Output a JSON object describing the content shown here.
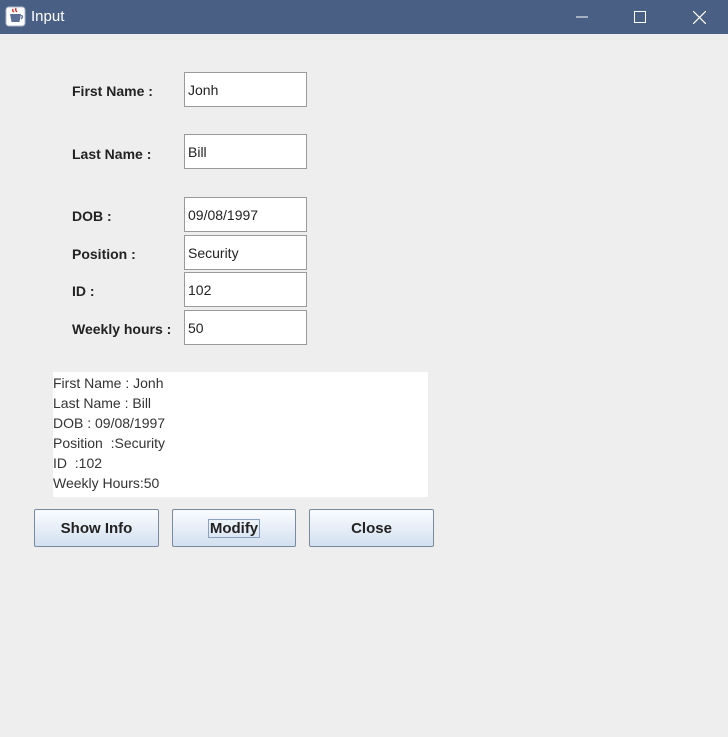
{
  "window": {
    "title": "Input",
    "app_icon": "java-cup-icon",
    "controls": [
      "minimize-icon",
      "maximize-icon",
      "close-icon"
    ]
  },
  "form": {
    "first_name": {
      "label": "First Name :",
      "value": "Jonh"
    },
    "last_name": {
      "label": "Last Name :",
      "value": "Bill"
    },
    "dob": {
      "label": "DOB :",
      "value": "09/08/1997"
    },
    "position": {
      "label": "Position :",
      "value": "Security"
    },
    "id": {
      "label": "ID :",
      "value": "102"
    },
    "weekly_hours": {
      "label": "Weekly hours :",
      "value": "50"
    }
  },
  "info": {
    "lines": [
      "First Name : Jonh",
      "Last Name : Bill",
      "DOB : 09/08/1997",
      "Position  :Security",
      "ID  :102",
      "Weekly Hours:50"
    ]
  },
  "buttons": {
    "show_info": "Show Info",
    "modify": "Modify",
    "close": "Close"
  },
  "colors": {
    "titlebar": "#4a5f84",
    "window_background": "#eeeeee",
    "button_gradient_top": "#fafcff",
    "button_gradient_bottom": "#d3e0f0"
  }
}
